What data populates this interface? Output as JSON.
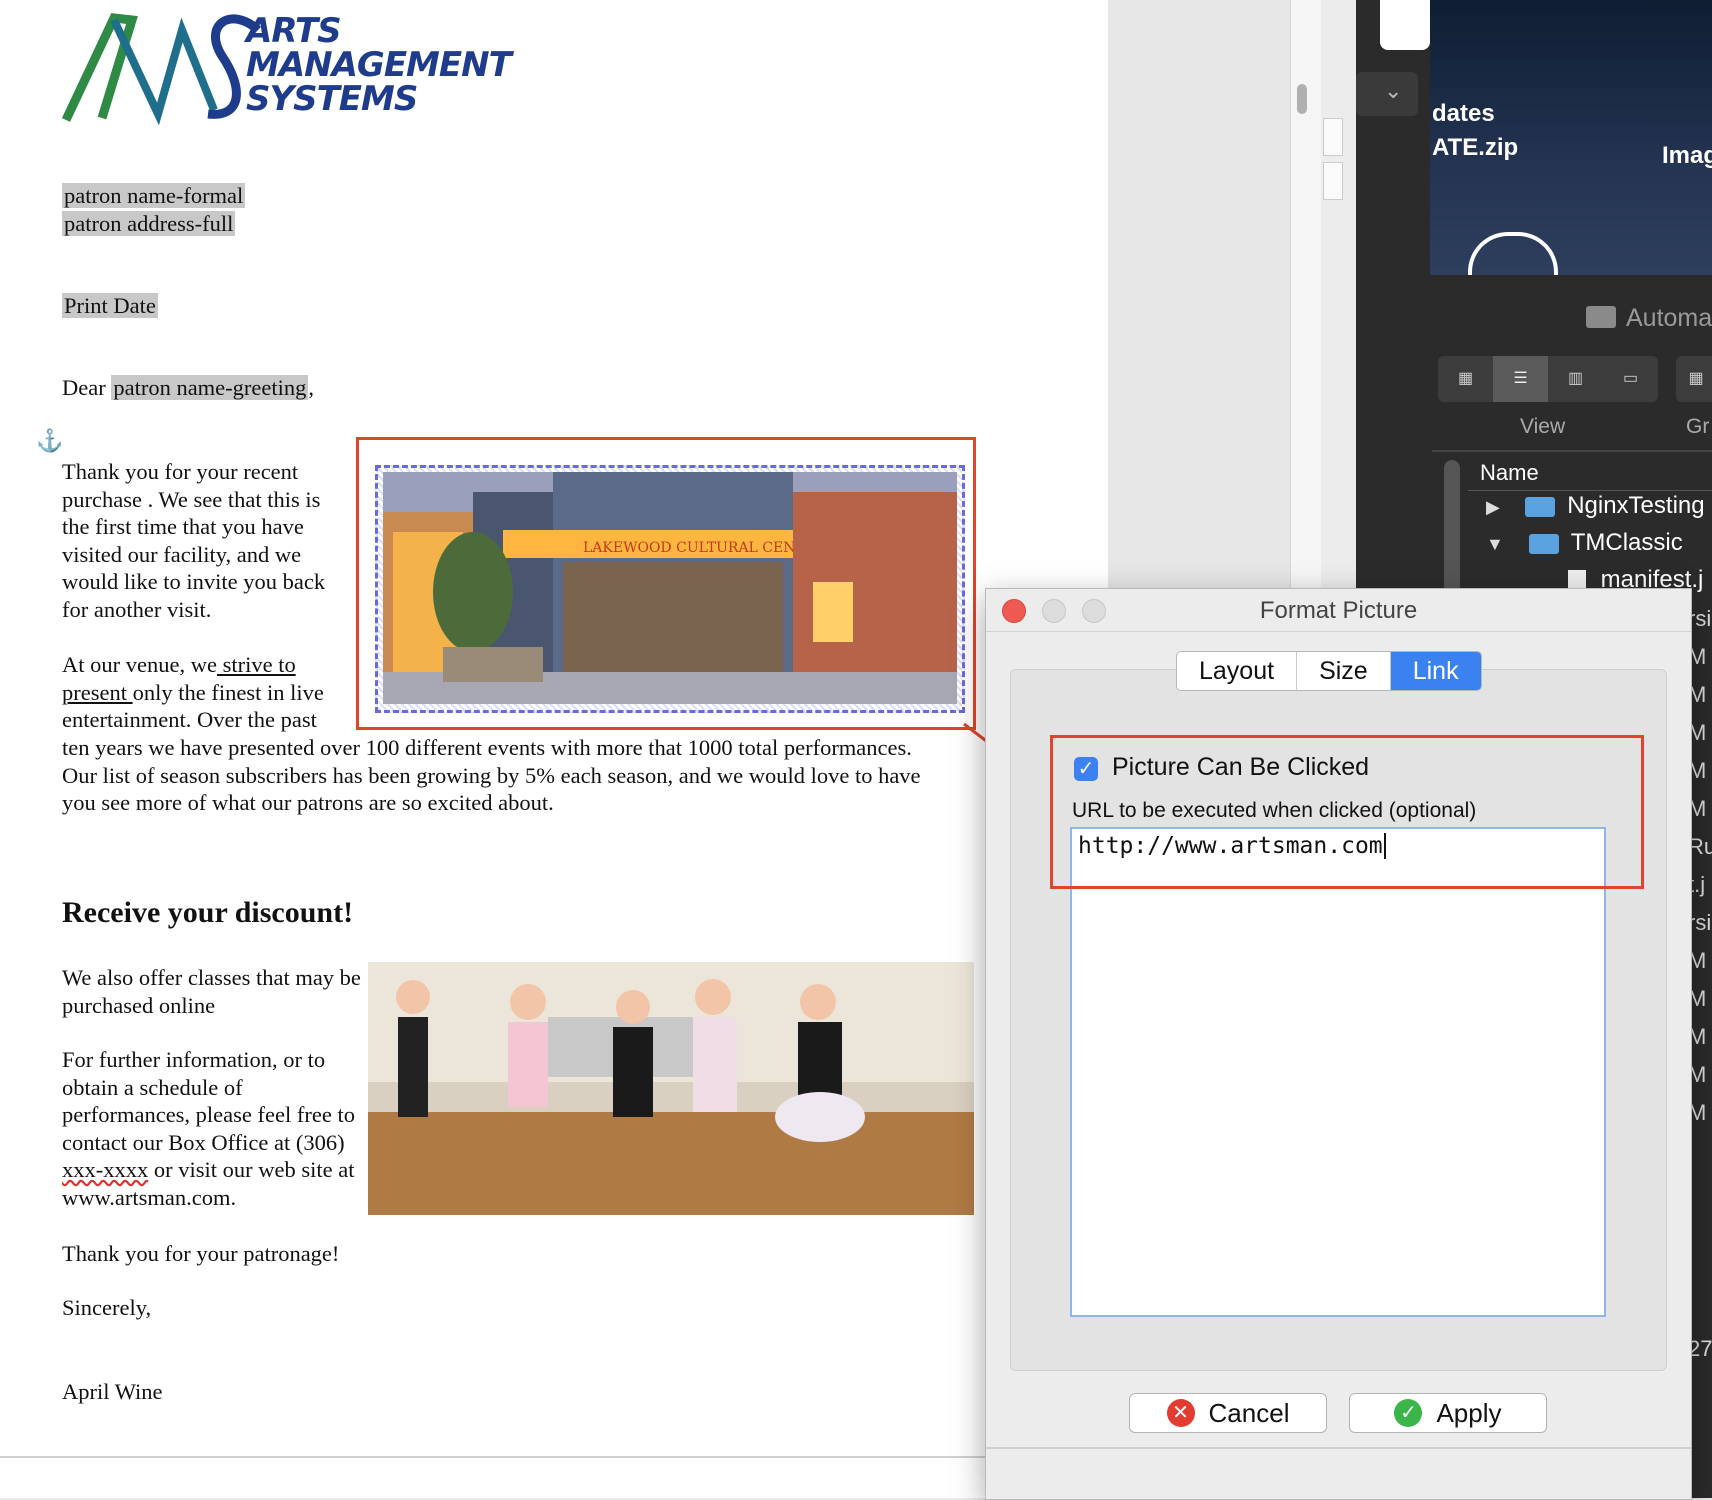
{
  "logo": {
    "monogram": "AMS",
    "text_lines": [
      "ARTS",
      "MANAGEMENT",
      "SYSTEMS"
    ]
  },
  "letter": {
    "patron_name_formal": "patron name-formal",
    "patron_address_full": "patron address-full",
    "print_date": "Print Date",
    "greeting_prefix": "Dear ",
    "greeting_field": "patron name-greeting",
    "greeting_suffix": ",",
    "anchor_glyph": "⚓",
    "para1": "Thank you for your recent purchase . We see that this is the first time that you have visited our facility, and we would like to invite you back for another visit.",
    "para2_a": "At our venue, we",
    "para2_link": " strive to present ",
    "para2_b": "only the finest in live entertainment. Over the past",
    "para2_c": "ten years we have presented over 100 different events with more that 1000 total performances. Our list of season subscribers has been growing by 5% each season, and we would love to have you see more of what our patrons are so excited about.",
    "heading": "Receive your discount!",
    "para3": "We also offer classes that may be purchased online",
    "para4_a": "For further information, or to obtain a schedule of performances, please feel free to contact our Box Office at (306) ",
    "para4_phone": "xxx-xxxx",
    "para4_b": " or visit our web site at www.artsman.com.",
    "thanks": "Thank you for your patronage!",
    "sincerely": "Sincerely,",
    "signature": "April Wine",
    "image1_sign": "LAKEWOOD CULTURAL CENTER"
  },
  "desktop": {
    "file_label_1": "dates",
    "file_label_2": "ATE.zip",
    "file_label_3": "Imag"
  },
  "finder": {
    "path_folder": "Automa",
    "view_label": "View",
    "group_label": "Gr",
    "col_name": "Name",
    "rows": [
      {
        "name": "NginxTesting",
        "expanded": false
      },
      {
        "name": "TMClassic",
        "expanded": true
      },
      {
        "name": "manifest.j",
        "expanded": false
      }
    ],
    "side_letters": [
      "rsi",
      "M",
      "M",
      "M",
      "M",
      "M",
      "Ru",
      "t.j",
      "rsi",
      "M",
      "M",
      "M",
      "M",
      "M",
      "27"
    ]
  },
  "dialog": {
    "title": "Format Picture",
    "tabs": [
      {
        "label": "Layout",
        "active": false
      },
      {
        "label": "Size",
        "active": false
      },
      {
        "label": "Link",
        "active": true
      }
    ],
    "checkbox_label": "Picture Can Be Clicked",
    "checkbox_checked": true,
    "url_label": "URL to be executed when clicked (optional)",
    "url_value": "http://www.artsman.com",
    "cancel_label": "Cancel",
    "apply_label": "Apply"
  },
  "colors": {
    "accent": "#3b82f0",
    "highlight": "#e0442b",
    "field_bg": "#c8c8c8",
    "logo_green": "#2f8a46",
    "logo_blue": "#1f3c8c"
  }
}
